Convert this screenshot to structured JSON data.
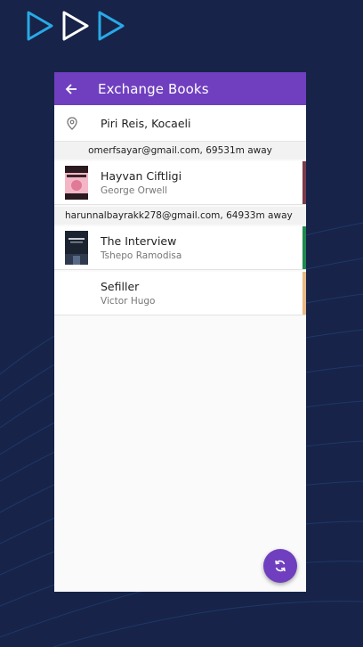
{
  "app": {
    "title": "Exchange Books"
  },
  "location": {
    "text": "Piri Reis, Kocaeli"
  },
  "groups": [
    {
      "owner": "omerfsayar@gmail.com, 69531m away",
      "books": [
        {
          "title": "Hayvan Ciftligi",
          "author": "George Orwell",
          "accent": "#7a3b4a",
          "cover": "pink"
        }
      ]
    },
    {
      "owner": "harunnalbayrakk278@gmail.com, 64933m away",
      "books": [
        {
          "title": "The Interview",
          "author": "Tshepo Ramodisa",
          "accent": "#1f8a4d",
          "cover": "dark"
        },
        {
          "title": "Sefiller",
          "author": "Victor Hugo",
          "accent": "#e8b985",
          "cover": "none"
        }
      ]
    }
  ],
  "icons": {
    "back": "arrow-left-icon",
    "location": "location-pin-icon",
    "refresh": "refresh-icon",
    "logo": "play-triangles-logo"
  },
  "colors": {
    "primary": "#6f3fbf",
    "background": "#172348"
  }
}
